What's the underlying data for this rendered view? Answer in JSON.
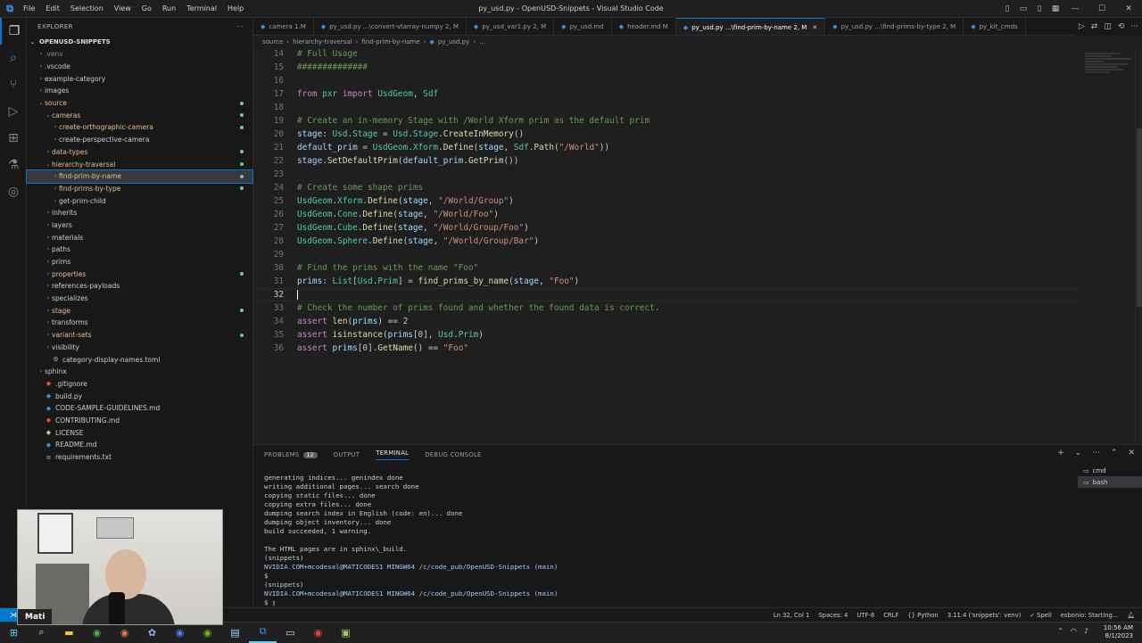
{
  "window": {
    "title": "py_usd.py - OpenUSD-Snippets - Visual Studio Code",
    "menu": [
      "File",
      "Edit",
      "Selection",
      "View",
      "Go",
      "Run",
      "Terminal",
      "Help"
    ]
  },
  "sidebar": {
    "header": "EXPLORER",
    "root": "OPENUSD-SNIPPETS",
    "items": [
      {
        "label": ".venv",
        "indent": 1,
        "type": "folder",
        "expanded": false,
        "state": "ignored",
        "dot": false
      },
      {
        "label": ".vscode",
        "indent": 1,
        "type": "folder",
        "expanded": false,
        "state": "normal",
        "dot": false
      },
      {
        "label": "example-category",
        "indent": 1,
        "type": "folder",
        "expanded": false,
        "state": "normal",
        "dot": false
      },
      {
        "label": "images",
        "indent": 1,
        "type": "folder",
        "expanded": false,
        "state": "normal",
        "dot": false
      },
      {
        "label": "source",
        "indent": 1,
        "type": "folder",
        "expanded": true,
        "state": "modified",
        "dot": true
      },
      {
        "label": "cameras",
        "indent": 2,
        "type": "folder",
        "expanded": true,
        "state": "modified",
        "dot": true
      },
      {
        "label": "create-orthographic-camera",
        "indent": 3,
        "type": "folder",
        "expanded": false,
        "state": "modified",
        "dot": true
      },
      {
        "label": "create-perspective-camera",
        "indent": 3,
        "type": "folder",
        "expanded": false,
        "state": "normal",
        "dot": false
      },
      {
        "label": "data-types",
        "indent": 2,
        "type": "folder",
        "expanded": false,
        "state": "modified",
        "dot": true
      },
      {
        "label": "hierarchy-traversal",
        "indent": 2,
        "type": "folder",
        "expanded": true,
        "state": "modified",
        "dot": true
      },
      {
        "label": "find-prim-by-name",
        "indent": 3,
        "type": "folder",
        "expanded": false,
        "state": "modified",
        "dot": true,
        "selected": true
      },
      {
        "label": "find-prims-by-type",
        "indent": 3,
        "type": "folder",
        "expanded": false,
        "state": "modified",
        "dot": true
      },
      {
        "label": "get-prim-child",
        "indent": 3,
        "type": "folder",
        "expanded": false,
        "state": "normal",
        "dot": false
      },
      {
        "label": "inherits",
        "indent": 2,
        "type": "folder",
        "expanded": false,
        "state": "normal",
        "dot": false
      },
      {
        "label": "layers",
        "indent": 2,
        "type": "folder",
        "expanded": false,
        "state": "normal",
        "dot": false
      },
      {
        "label": "materials",
        "indent": 2,
        "type": "folder",
        "expanded": false,
        "state": "normal",
        "dot": false
      },
      {
        "label": "paths",
        "indent": 2,
        "type": "folder",
        "expanded": false,
        "state": "normal",
        "dot": false
      },
      {
        "label": "prims",
        "indent": 2,
        "type": "folder",
        "expanded": false,
        "state": "normal",
        "dot": false
      },
      {
        "label": "properties",
        "indent": 2,
        "type": "folder",
        "expanded": false,
        "state": "modified",
        "dot": true
      },
      {
        "label": "references-payloads",
        "indent": 2,
        "type": "folder",
        "expanded": false,
        "state": "normal",
        "dot": false
      },
      {
        "label": "specializes",
        "indent": 2,
        "type": "folder",
        "expanded": false,
        "state": "normal",
        "dot": false
      },
      {
        "label": "stage",
        "indent": 2,
        "type": "folder",
        "expanded": false,
        "state": "modified",
        "dot": true
      },
      {
        "label": "transforms",
        "indent": 2,
        "type": "folder",
        "expanded": false,
        "state": "normal",
        "dot": false
      },
      {
        "label": "variant-sets",
        "indent": 2,
        "type": "folder",
        "expanded": false,
        "state": "modified",
        "dot": true
      },
      {
        "label": "visibility",
        "indent": 2,
        "type": "folder",
        "expanded": false,
        "state": "normal",
        "dot": false
      },
      {
        "label": "category-display-names.toml",
        "indent": 2,
        "type": "file",
        "icon": "⚙",
        "iconColor": "#aaaaaa",
        "state": "normal",
        "dot": false
      },
      {
        "label": "sphinx",
        "indent": 1,
        "type": "folder",
        "expanded": false,
        "state": "normal",
        "dot": false
      },
      {
        "label": ".gitignore",
        "indent": 1,
        "type": "file",
        "icon": "◆",
        "iconColor": "#e5533d",
        "state": "normal",
        "dot": false
      },
      {
        "label": "build.py",
        "indent": 1,
        "type": "file",
        "icon": "◆",
        "iconColor": "#3b8eea",
        "state": "normal",
        "dot": false
      },
      {
        "label": "CODE-SAMPLE-GUIDELINES.md",
        "indent": 1,
        "type": "file",
        "icon": "◆",
        "iconColor": "#3b8eea",
        "state": "normal",
        "dot": false
      },
      {
        "label": "CONTRIBUTING.md",
        "indent": 1,
        "type": "file",
        "icon": "◆",
        "iconColor": "#e5533d",
        "state": "normal",
        "dot": false
      },
      {
        "label": "LICENSE",
        "indent": 1,
        "type": "file",
        "icon": "◆",
        "iconColor": "#e2c08d",
        "state": "normal",
        "dot": false
      },
      {
        "label": "README.md",
        "indent": 1,
        "type": "file",
        "icon": "◆",
        "iconColor": "#3b8eea",
        "state": "normal",
        "dot": false
      },
      {
        "label": "requirements.txt",
        "indent": 1,
        "type": "file",
        "icon": "≡",
        "iconColor": "#aaaaaa",
        "state": "normal",
        "dot": false
      }
    ]
  },
  "tabs": [
    {
      "label": "camera 1.M",
      "mod": "",
      "active": false
    },
    {
      "label": "py_usd.py ...\\convert-vtarray-numpy 2, M",
      "mod": "",
      "active": false
    },
    {
      "label": "py_usd_var1.py 2, M",
      "mod": "",
      "active": false
    },
    {
      "label": "py_usd.md",
      "mod": "",
      "active": false
    },
    {
      "label": "header.md M",
      "mod": "",
      "active": false
    },
    {
      "label": "py_usd.py ...\\find-prim-by-name 2, M",
      "mod": "",
      "active": true
    },
    {
      "label": "py_usd.py ...\\find-prims-by-type 2, M",
      "mod": "",
      "active": false
    },
    {
      "label": "py_kit_cmds",
      "mod": "",
      "active": false
    }
  ],
  "breadcrumbs": [
    "source",
    "hierarchy-traversal",
    "find-prim-by-name",
    "py_usd.py",
    "..."
  ],
  "editor": {
    "lines": [
      {
        "n": "14",
        "tokens": [
          [
            "cm",
            "# Full Usage"
          ]
        ]
      },
      {
        "n": "15",
        "tokens": [
          [
            "cm",
            "##############"
          ]
        ]
      },
      {
        "n": "16",
        "tokens": []
      },
      {
        "n": "17",
        "tokens": [
          [
            "kw",
            "from"
          ],
          [
            "",
            " "
          ],
          [
            "ty",
            "pxr"
          ],
          [
            "",
            " "
          ],
          [
            "kw",
            "import"
          ],
          [
            "",
            " "
          ],
          [
            "ty",
            "UsdGeom"
          ],
          [
            "",
            ", "
          ],
          [
            "ty",
            "Sdf"
          ]
        ]
      },
      {
        "n": "18",
        "tokens": []
      },
      {
        "n": "19",
        "tokens": [
          [
            "cm",
            "# Create an in-memory Stage with /World Xform prim as the default prim"
          ]
        ]
      },
      {
        "n": "20",
        "tokens": [
          [
            "vr",
            "stage"
          ],
          [
            "",
            ": "
          ],
          [
            "ty",
            "Usd"
          ],
          [
            "",
            "."
          ],
          [
            "ty",
            "Stage"
          ],
          [
            "",
            " = "
          ],
          [
            "ty",
            "Usd"
          ],
          [
            "",
            "."
          ],
          [
            "ty",
            "Stage"
          ],
          [
            "",
            "."
          ],
          [
            "fn",
            "CreateInMemory"
          ],
          [
            "",
            "()"
          ]
        ]
      },
      {
        "n": "21",
        "tokens": [
          [
            "vr",
            "default_prim"
          ],
          [
            "",
            " = "
          ],
          [
            "ty",
            "UsdGeom"
          ],
          [
            "",
            "."
          ],
          [
            "ty",
            "Xform"
          ],
          [
            "",
            "."
          ],
          [
            "fn",
            "Define"
          ],
          [
            "",
            "("
          ],
          [
            "vr",
            "stage"
          ],
          [
            "",
            ", "
          ],
          [
            "ty",
            "Sdf"
          ],
          [
            "",
            "."
          ],
          [
            "fn",
            "Path"
          ],
          [
            "",
            "("
          ],
          [
            "st",
            "\"/World\""
          ],
          [
            "",
            "))"
          ]
        ]
      },
      {
        "n": "22",
        "tokens": [
          [
            "vr",
            "stage"
          ],
          [
            "",
            "."
          ],
          [
            "fn",
            "SetDefaultPrim"
          ],
          [
            "",
            "("
          ],
          [
            "vr",
            "default_prim"
          ],
          [
            "",
            "."
          ],
          [
            "fn",
            "GetPrim"
          ],
          [
            "",
            "())"
          ]
        ]
      },
      {
        "n": "23",
        "tokens": []
      },
      {
        "n": "24",
        "tokens": [
          [
            "cm",
            "# Create some shape prims"
          ]
        ]
      },
      {
        "n": "25",
        "tokens": [
          [
            "ty",
            "UsdGeom"
          ],
          [
            "",
            "."
          ],
          [
            "ty",
            "Xform"
          ],
          [
            "",
            "."
          ],
          [
            "fn",
            "Define"
          ],
          [
            "",
            "("
          ],
          [
            "vr",
            "stage"
          ],
          [
            "",
            ", "
          ],
          [
            "st",
            "\"/World/Group\""
          ],
          [
            "",
            ")"
          ]
        ]
      },
      {
        "n": "26",
        "tokens": [
          [
            "ty",
            "UsdGeom"
          ],
          [
            "",
            "."
          ],
          [
            "ty",
            "Cone"
          ],
          [
            "",
            "."
          ],
          [
            "fn",
            "Define"
          ],
          [
            "",
            "("
          ],
          [
            "vr",
            "stage"
          ],
          [
            "",
            ", "
          ],
          [
            "st",
            "\"/World/Foo\""
          ],
          [
            "",
            ")"
          ]
        ]
      },
      {
        "n": "27",
        "tokens": [
          [
            "ty",
            "UsdGeom"
          ],
          [
            "",
            "."
          ],
          [
            "ty",
            "Cube"
          ],
          [
            "",
            "."
          ],
          [
            "fn",
            "Define"
          ],
          [
            "",
            "("
          ],
          [
            "vr",
            "stage"
          ],
          [
            "",
            ", "
          ],
          [
            "st",
            "\"/World/Group/Foo\""
          ],
          [
            "",
            ")"
          ]
        ]
      },
      {
        "n": "28",
        "tokens": [
          [
            "ty",
            "UsdGeom"
          ],
          [
            "",
            "."
          ],
          [
            "ty",
            "Sphere"
          ],
          [
            "",
            "."
          ],
          [
            "fn",
            "Define"
          ],
          [
            "",
            "("
          ],
          [
            "vr",
            "stage"
          ],
          [
            "",
            ", "
          ],
          [
            "st",
            "\"/World/Group/Bar\""
          ],
          [
            "",
            ")"
          ]
        ]
      },
      {
        "n": "29",
        "tokens": []
      },
      {
        "n": "30",
        "tokens": [
          [
            "cm",
            "# Find the prims with the name \"Foo\""
          ]
        ]
      },
      {
        "n": "31",
        "tokens": [
          [
            "vr",
            "prims"
          ],
          [
            "",
            ": "
          ],
          [
            "ty",
            "List"
          ],
          [
            "",
            "["
          ],
          [
            "ty",
            "Usd"
          ],
          [
            "",
            "."
          ],
          [
            "ty",
            "Prim"
          ],
          [
            "",
            "] = "
          ],
          [
            "fn",
            "find_prims_by_name"
          ],
          [
            "",
            "("
          ],
          [
            "vr",
            "stage"
          ],
          [
            "",
            ", "
          ],
          [
            "st",
            "\"Foo\""
          ],
          [
            "",
            ")"
          ]
        ]
      },
      {
        "n": "32",
        "tokens": [],
        "current": true
      },
      {
        "n": "33",
        "tokens": [
          [
            "cm",
            "# Check the number of prims found and whether the found data is correct."
          ]
        ]
      },
      {
        "n": "34",
        "tokens": [
          [
            "kw",
            "assert"
          ],
          [
            "",
            " "
          ],
          [
            "fn",
            "len"
          ],
          [
            "",
            "("
          ],
          [
            "vr",
            "prims"
          ],
          [
            "",
            ") == "
          ],
          [
            "nm",
            "2"
          ]
        ]
      },
      {
        "n": "35",
        "tokens": [
          [
            "kw",
            "assert"
          ],
          [
            "",
            " "
          ],
          [
            "fn",
            "isinstance"
          ],
          [
            "",
            "("
          ],
          [
            "vr",
            "prims"
          ],
          [
            "",
            "["
          ],
          [
            "nm",
            "0"
          ],
          [
            "",
            "], "
          ],
          [
            "ty",
            "Usd"
          ],
          [
            "",
            "."
          ],
          [
            "ty",
            "Prim"
          ],
          [
            "",
            ")"
          ]
        ]
      },
      {
        "n": "36",
        "tokens": [
          [
            "kw",
            "assert"
          ],
          [
            "",
            " "
          ],
          [
            "vr",
            "prims"
          ],
          [
            "",
            "["
          ],
          [
            "nm",
            "0"
          ],
          [
            "",
            "]."
          ],
          [
            "fn",
            "GetName"
          ],
          [
            "",
            "() == "
          ],
          [
            "st",
            "\"Foo\""
          ]
        ]
      }
    ]
  },
  "panel": {
    "tabs": [
      {
        "label": "PROBLEMS",
        "badge": "12",
        "active": false
      },
      {
        "label": "OUTPUT",
        "active": false
      },
      {
        "label": "TERMINAL",
        "active": true
      },
      {
        "label": "DEBUG CONSOLE",
        "active": false
      }
    ],
    "terminal_lines": [
      {
        "t": "generating indices... genindex done",
        "p": false
      },
      {
        "t": "writing additional pages... search done",
        "p": false
      },
      {
        "t": "copying static files... done",
        "p": false
      },
      {
        "t": "copying extra files... done",
        "p": false
      },
      {
        "t": "dumping search index in English (code: en)... done",
        "p": false
      },
      {
        "t": "dumping object inventory... done",
        "p": false
      },
      {
        "t": "build succeeded, 1 warning.",
        "p": false
      },
      {
        "t": "",
        "p": false
      },
      {
        "t": "The HTML pages are in sphinx\\_build.",
        "p": false
      },
      {
        "t": "(snippets)",
        "p": false
      },
      {
        "t": "NVIDIA.COM+mcodesal@MATICODES1 MINGW64 /c/code_pub/OpenUSD-Snippets (main)",
        "p": true
      },
      {
        "t": "$",
        "p": false
      },
      {
        "t": "(snippets)",
        "p": false
      },
      {
        "t": "NVIDIA.COM+mcodesal@MATICODES1 MINGW64 /c/code_pub/OpenUSD-Snippets (main)",
        "p": true
      },
      {
        "t": "$ ▯",
        "p": false
      }
    ],
    "terminals": [
      {
        "label": "cmd",
        "active": false
      },
      {
        "label": "bash",
        "active": true
      }
    ]
  },
  "status": {
    "items": [
      "Ln 32, Col 1",
      "Spaces: 4",
      "UTF-8",
      "CRLF",
      "{} Python",
      "3.11.4 ('snippets': venv)",
      "✓ Spell",
      "esbonio: Starting..."
    ]
  },
  "taskbar": {
    "time": "10:56 AM",
    "date": "8/1/2023"
  },
  "webcam": {
    "name": "Mati"
  }
}
